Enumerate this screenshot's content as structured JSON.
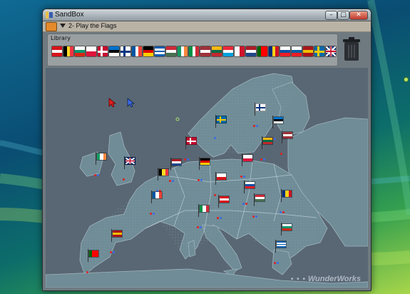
{
  "window": {
    "title": "SandBox",
    "menu_label": "2- Play the Flags",
    "controls": {
      "minimize": "–",
      "maximize": "□",
      "close": "✕"
    }
  },
  "library": {
    "label": "Library",
    "flags": [
      {
        "country": "Austria",
        "stripes": "h",
        "colors": [
          "#d7141a",
          "#ffffff",
          "#d7141a"
        ]
      },
      {
        "country": "Belgium",
        "stripes": "v",
        "colors": [
          "#000000",
          "#fdda24",
          "#ef3340"
        ]
      },
      {
        "country": "Bulgaria",
        "stripes": "h",
        "colors": [
          "#ffffff",
          "#00966e",
          "#d62612"
        ]
      },
      {
        "country": "Poland",
        "stripes": "h",
        "colors": [
          "#ffffff",
          "#dc143c"
        ]
      },
      {
        "country": "Denmark",
        "stripes": "cross",
        "colors": [
          "#c60c30",
          "#ffffff"
        ]
      },
      {
        "country": "Estonia",
        "stripes": "h",
        "colors": [
          "#0072ce",
          "#000000",
          "#ffffff"
        ]
      },
      {
        "country": "Finland",
        "stripes": "cross",
        "colors": [
          "#ffffff",
          "#003580"
        ]
      },
      {
        "country": "France",
        "stripes": "v",
        "colors": [
          "#0055a4",
          "#ffffff",
          "#ef4135"
        ]
      },
      {
        "country": "Germany",
        "stripes": "h",
        "colors": [
          "#000000",
          "#dd0000",
          "#ffce00"
        ]
      },
      {
        "country": "Greece",
        "stripes": "h",
        "colors": [
          "#0d5eaf",
          "#ffffff",
          "#0d5eaf",
          "#ffffff",
          "#0d5eaf"
        ]
      },
      {
        "country": "Hungary",
        "stripes": "h",
        "colors": [
          "#ce2939",
          "#ffffff",
          "#477050"
        ]
      },
      {
        "country": "Ireland",
        "stripes": "v",
        "colors": [
          "#169b62",
          "#ffffff",
          "#ff883e"
        ]
      },
      {
        "country": "Italy",
        "stripes": "v",
        "colors": [
          "#009246",
          "#ffffff",
          "#ce2b37"
        ]
      },
      {
        "country": "Latvia",
        "stripes": "h",
        "colors": [
          "#9e3039",
          "#ffffff",
          "#9e3039"
        ]
      },
      {
        "country": "Lithuania",
        "stripes": "h",
        "colors": [
          "#fdb913",
          "#006a44",
          "#c1272d"
        ]
      },
      {
        "country": "Luxembourg",
        "stripes": "h",
        "colors": [
          "#ed2939",
          "#ffffff",
          "#00a1de"
        ]
      },
      {
        "country": "Malta",
        "stripes": "v",
        "colors": [
          "#ffffff",
          "#cf142b"
        ]
      },
      {
        "country": "Netherlands",
        "stripes": "h",
        "colors": [
          "#ae1c28",
          "#ffffff",
          "#21468b"
        ]
      },
      {
        "country": "Portugal",
        "stripes": "v",
        "colors": [
          "#006600",
          "#ff0000",
          "#ff0000"
        ]
      },
      {
        "country": "Romania",
        "stripes": "v",
        "colors": [
          "#002b7f",
          "#fcd116",
          "#ce1126"
        ]
      },
      {
        "country": "Slovakia",
        "stripes": "h",
        "colors": [
          "#ffffff",
          "#0b4ea2",
          "#ee1c25"
        ]
      },
      {
        "country": "Slovenia",
        "stripes": "h",
        "colors": [
          "#ffffff",
          "#005da4",
          "#ed1c24"
        ]
      },
      {
        "country": "Spain",
        "stripes": "h",
        "colors": [
          "#aa151b",
          "#f1bf00",
          "#aa151b"
        ]
      },
      {
        "country": "Sweden",
        "stripes": "cross",
        "colors": [
          "#006aa7",
          "#fecc00"
        ]
      },
      {
        "country": "United Kingdom",
        "stripes": "uk",
        "colors": [
          "#012169",
          "#ffffff",
          "#c8102e"
        ]
      }
    ]
  },
  "trash_icon": "trash-can-icon",
  "map_flags": [
    {
      "country": "Finland",
      "stripes": "cross",
      "colors": [
        "#ffffff",
        "#003580"
      ]
    },
    {
      "country": "Sweden",
      "stripes": "cross",
      "colors": [
        "#006aa7",
        "#fecc00"
      ]
    },
    {
      "country": "Estonia",
      "stripes": "h",
      "colors": [
        "#0072ce",
        "#000000",
        "#ffffff"
      ]
    },
    {
      "country": "Latvia",
      "stripes": "h",
      "colors": [
        "#9e3039",
        "#ffffff",
        "#9e3039"
      ]
    },
    {
      "country": "Lithuania",
      "stripes": "h",
      "colors": [
        "#fdb913",
        "#006a44",
        "#c1272d"
      ]
    },
    {
      "country": "Denmark",
      "stripes": "cross",
      "colors": [
        "#c60c30",
        "#ffffff"
      ]
    },
    {
      "country": "Ireland",
      "stripes": "v",
      "colors": [
        "#169b62",
        "#ffffff",
        "#ff883e"
      ]
    },
    {
      "country": "United Kingdom",
      "stripes": "uk",
      "colors": [
        "#012169",
        "#ffffff",
        "#c8102e"
      ]
    },
    {
      "country": "Netherlands",
      "stripes": "h",
      "colors": [
        "#ae1c28",
        "#ffffff",
        "#21468b"
      ]
    },
    {
      "country": "Belgium",
      "stripes": "v",
      "colors": [
        "#000000",
        "#fdda24",
        "#ef3340"
      ]
    },
    {
      "country": "Germany",
      "stripes": "h",
      "colors": [
        "#000000",
        "#dd0000",
        "#ffce00"
      ]
    },
    {
      "country": "Poland",
      "stripes": "h",
      "colors": [
        "#ffffff",
        "#dc143c"
      ]
    },
    {
      "country": "Czech Republic",
      "stripes": "h",
      "colors": [
        "#ffffff",
        "#d7141a"
      ]
    },
    {
      "country": "Slovakia",
      "stripes": "h",
      "colors": [
        "#ffffff",
        "#0b4ea2",
        "#ee1c25"
      ]
    },
    {
      "country": "France",
      "stripes": "v",
      "colors": [
        "#0055a4",
        "#ffffff",
        "#ef4135"
      ]
    },
    {
      "country": "Austria",
      "stripes": "h",
      "colors": [
        "#d7141a",
        "#ffffff",
        "#d7141a"
      ]
    },
    {
      "country": "Hungary",
      "stripes": "h",
      "colors": [
        "#ce2939",
        "#ffffff",
        "#477050"
      ]
    },
    {
      "country": "Romania",
      "stripes": "v",
      "colors": [
        "#002b7f",
        "#fcd116",
        "#ce1126"
      ]
    },
    {
      "country": "Italy",
      "stripes": "v",
      "colors": [
        "#009246",
        "#ffffff",
        "#ce2b37"
      ]
    },
    {
      "country": "Bulgaria",
      "stripes": "h",
      "colors": [
        "#ffffff",
        "#00966e",
        "#d62612"
      ]
    },
    {
      "country": "Spain",
      "stripes": "h",
      "colors": [
        "#aa151b",
        "#f1bf00",
        "#aa151b"
      ]
    },
    {
      "country": "Portugal",
      "stripes": "v",
      "colors": [
        "#006600",
        "#ff0000",
        "#ff0000"
      ]
    },
    {
      "country": "Greece",
      "stripes": "h",
      "colors": [
        "#0d5eaf",
        "#ffffff",
        "#0d5eaf",
        "#ffffff",
        "#0d5eaf"
      ]
    }
  ],
  "cursors": [
    {
      "color": "#e02020"
    },
    {
      "color": "#3a6be8"
    }
  ],
  "watermark": {
    "dots": "• • •",
    "text": "WunderWorks"
  },
  "colors": {
    "land": "#6f8c97",
    "sea": "#596774",
    "accent": "#e58a2a"
  }
}
